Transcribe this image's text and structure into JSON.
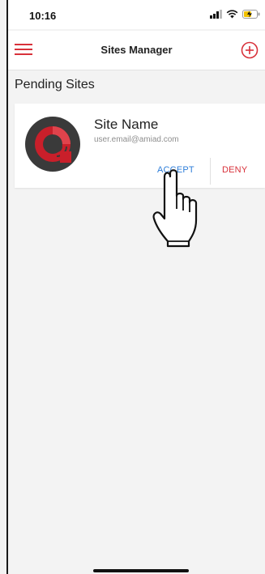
{
  "status_bar": {
    "time": "10:16",
    "icons": [
      "signal-icon",
      "wifi-icon",
      "battery-icon"
    ]
  },
  "header": {
    "title": "Sites Manager",
    "left_icon": "menu-icon",
    "right_icon": "add-circle-icon"
  },
  "section": {
    "title": "Pending Sites"
  },
  "pending_sites": [
    {
      "name": "Site Name",
      "email": "user.email@amiad.com",
      "accept_label": "ACCEPT",
      "deny_label": "DENY"
    }
  ],
  "colors": {
    "accent": "#d8313a",
    "accept": "#2e7ed9",
    "background": "#f3f3f3",
    "card": "#ffffff"
  }
}
